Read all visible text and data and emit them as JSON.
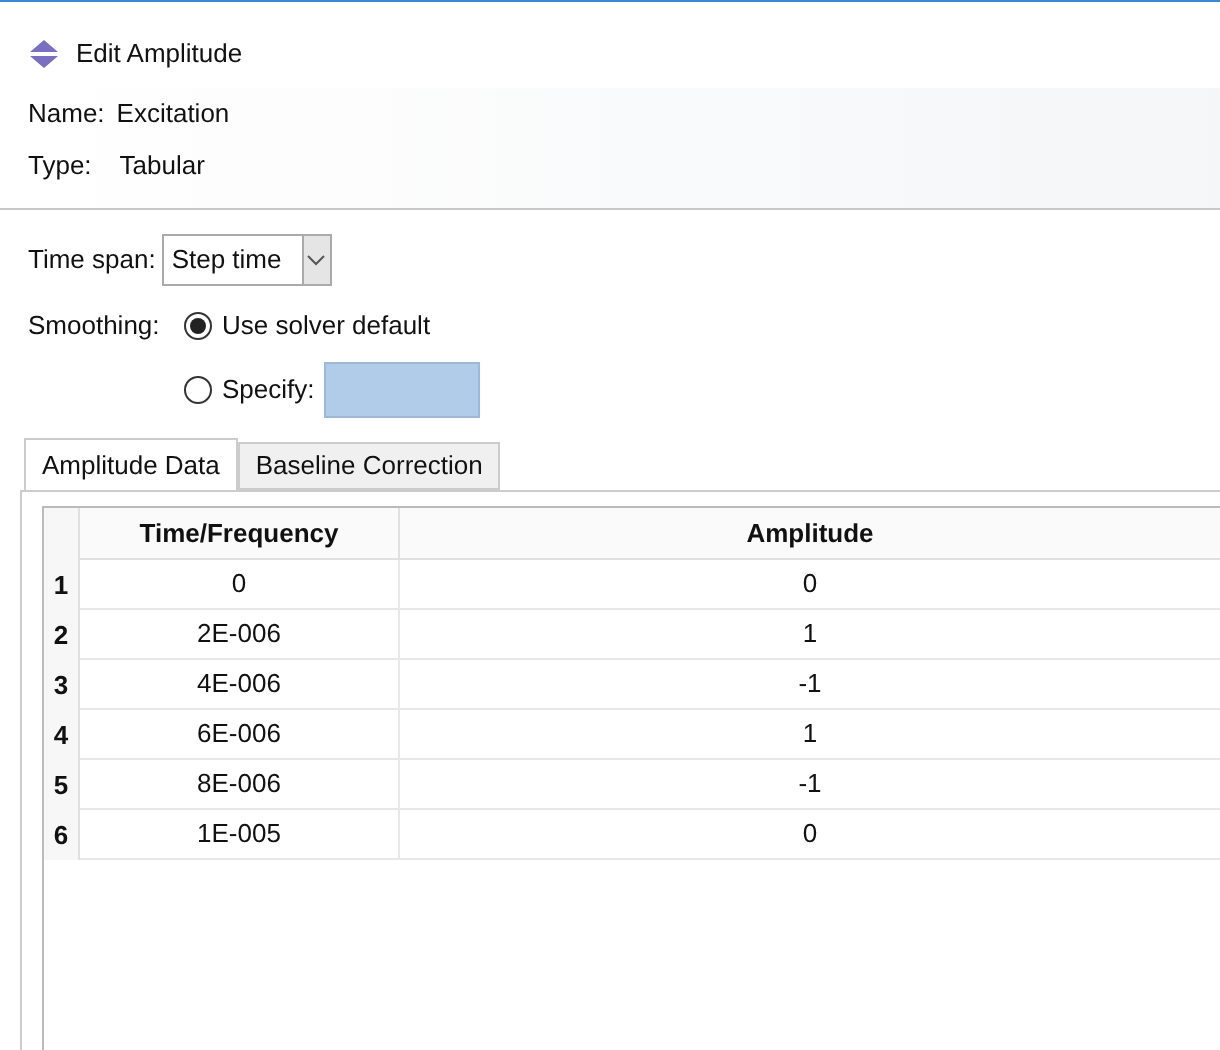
{
  "window": {
    "title": "Edit Amplitude"
  },
  "name": {
    "label": "Name:",
    "value": "Excitation"
  },
  "type": {
    "label": "Type:",
    "value": "Tabular"
  },
  "time_span": {
    "label": "Time span:",
    "value": "Step time"
  },
  "smoothing": {
    "label": "Smoothing:",
    "options": [
      {
        "label": "Use solver default",
        "selected": true,
        "kind": "plain"
      },
      {
        "label": "Specify:",
        "selected": false,
        "kind": "field"
      }
    ]
  },
  "tabs": [
    {
      "label": "Amplitude Data",
      "selected": true
    },
    {
      "label": "Baseline Correction",
      "selected": false
    }
  ],
  "table": {
    "columns": [
      "Time/Frequency",
      "Amplitude"
    ],
    "rows": [
      {
        "index": "1",
        "cells": [
          "0",
          "0"
        ]
      },
      {
        "index": "2",
        "cells": [
          "2E-006",
          "1"
        ]
      },
      {
        "index": "3",
        "cells": [
          "4E-006",
          "-1"
        ]
      },
      {
        "index": "4",
        "cells": [
          "6E-006",
          "1"
        ]
      },
      {
        "index": "5",
        "cells": [
          "8E-006",
          "-1"
        ]
      },
      {
        "index": "6",
        "cells": [
          "1E-005",
          "0"
        ]
      }
    ]
  }
}
